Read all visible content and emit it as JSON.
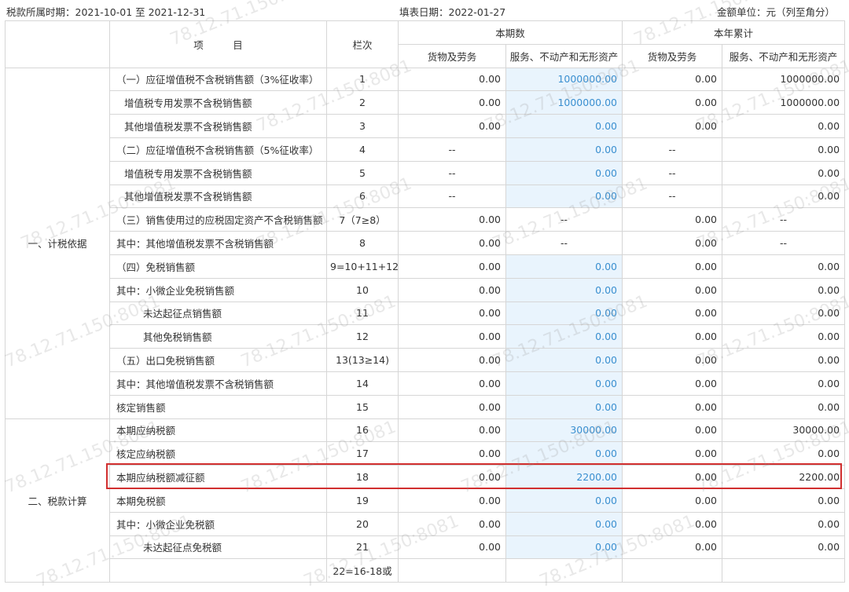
{
  "header": {
    "period_label": "税款所属时期：2021-10-01 至 2021-12-31",
    "fill_date_label": "填表日期：2022-01-27",
    "unit_label": "金额单位：元（列至角分）"
  },
  "table": {
    "h_item": "项　　　目",
    "h_col": "栏次",
    "h_current": "本期数",
    "h_ytd": "本年累计",
    "h_goods": "货物及劳务",
    "h_services": "服务、不动产和无形资产",
    "sections": [
      "一、计税依据",
      "二、税款计算"
    ],
    "rows": [
      {
        "name": "（一）应征增值税不含税销售额（3%征收率）",
        "col": "1",
        "a": "0.00",
        "b": "1000000.00",
        "c": "0.00",
        "d": "1000000.00"
      },
      {
        "name": "增值税专用发票不含税销售额",
        "col": "2",
        "a": "0.00",
        "b": "1000000.00",
        "c": "0.00",
        "d": "1000000.00"
      },
      {
        "name": "其他增值税发票不含税销售额",
        "col": "3",
        "a": "0.00",
        "b": "0.00",
        "c": "0.00",
        "d": "0.00"
      },
      {
        "name": "（二）应征增值税不含税销售额（5%征收率）",
        "col": "4",
        "a": "--",
        "b": "0.00",
        "c": "--",
        "d": "0.00"
      },
      {
        "name": "增值税专用发票不含税销售额",
        "col": "5",
        "a": "--",
        "b": "0.00",
        "c": "--",
        "d": "0.00"
      },
      {
        "name": "其他增值税发票不含税销售额",
        "col": "6",
        "a": "--",
        "b": "0.00",
        "c": "--",
        "d": "0.00"
      },
      {
        "name": "（三）销售使用过的应税固定资产不含税销售额",
        "col": "7（7≥8）",
        "a": "0.00",
        "b": "--",
        "c": "0.00",
        "d": "--"
      },
      {
        "name": "其中：其他增值税发票不含税销售额",
        "col": "8",
        "a": "0.00",
        "b": "--",
        "c": "0.00",
        "d": "--"
      },
      {
        "name": "（四）免税销售额",
        "col": "9=10+11+12",
        "a": "0.00",
        "b": "0.00",
        "c": "0.00",
        "d": "0.00"
      },
      {
        "name": "其中：小微企业免税销售额",
        "col": "10",
        "a": "0.00",
        "b": "0.00",
        "c": "0.00",
        "d": "0.00"
      },
      {
        "name": "未达起征点销售额",
        "col": "11",
        "a": "0.00",
        "b": "0.00",
        "c": "0.00",
        "d": "0.00"
      },
      {
        "name": "其他免税销售额",
        "col": "12",
        "a": "0.00",
        "b": "0.00",
        "c": "0.00",
        "d": "0.00"
      },
      {
        "name": "（五）出口免税销售额",
        "col": "13(13≥14)",
        "a": "0.00",
        "b": "0.00",
        "c": "0.00",
        "d": "0.00"
      },
      {
        "name": "其中：其他增值税发票不含税销售额",
        "col": "14",
        "a": "0.00",
        "b": "0.00",
        "c": "0.00",
        "d": "0.00"
      },
      {
        "name": "核定销售额",
        "col": "15",
        "a": "0.00",
        "b": "0.00",
        "c": "0.00",
        "d": "0.00"
      },
      {
        "name": "本期应纳税额",
        "col": "16",
        "a": "0.00",
        "b": "30000.00",
        "c": "0.00",
        "d": "30000.00"
      },
      {
        "name": "核定应纳税额",
        "col": "17",
        "a": "0.00",
        "b": "0.00",
        "c": "0.00",
        "d": "0.00"
      },
      {
        "name": "本期应纳税额减征额",
        "col": "18",
        "a": "0.00",
        "b": "2200.00",
        "c": "0.00",
        "d": "2200.00"
      },
      {
        "name": "本期免税额",
        "col": "19",
        "a": "0.00",
        "b": "0.00",
        "c": "0.00",
        "d": "0.00"
      },
      {
        "name": "其中：小微企业免税额",
        "col": "20",
        "a": "0.00",
        "b": "0.00",
        "c": "0.00",
        "d": "0.00"
      },
      {
        "name": "未达起征点免税额",
        "col": "21",
        "a": "0.00",
        "b": "0.00",
        "c": "0.00",
        "d": "0.00"
      },
      {
        "name": "",
        "col": "22=16-18或",
        "a": "",
        "b": "",
        "c": "",
        "d": ""
      }
    ]
  },
  "watermark": "78.12.71.150:8081",
  "colors": {
    "highlight_border": "#d12f2f",
    "input_cell_bg": "#e9f4fd",
    "input_cell_text": "#3a8fd0"
  }
}
